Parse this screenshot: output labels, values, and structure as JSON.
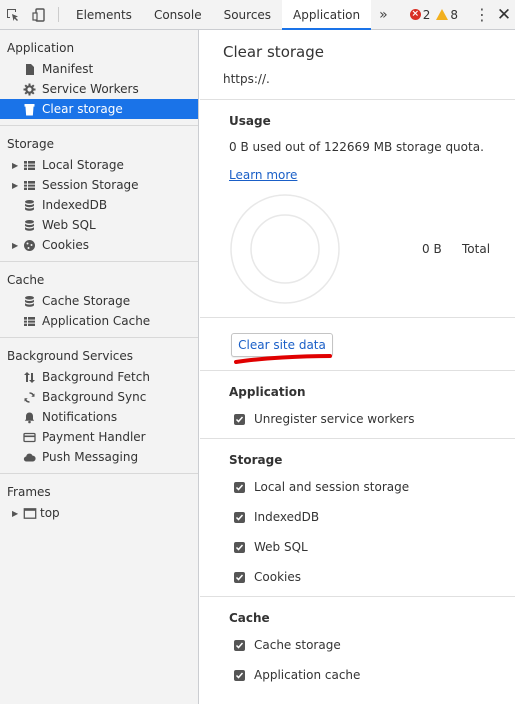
{
  "toolbar": {
    "tabs": [
      {
        "label": "Elements"
      },
      {
        "label": "Console"
      },
      {
        "label": "Sources"
      },
      {
        "label": "Application"
      }
    ],
    "more_tabs": "»",
    "errors": "2",
    "warnings": "8",
    "active_tab_color": "#1a73e8",
    "error_color": "#d93025",
    "warning_color": "#f2b01e"
  },
  "sidebar": {
    "application": {
      "title": "Application",
      "items": [
        {
          "label": "Manifest",
          "icon": "document-icon"
        },
        {
          "label": "Service Workers",
          "icon": "gear-icon"
        },
        {
          "label": "Clear storage",
          "icon": "trash-icon",
          "selected": true
        }
      ]
    },
    "storage": {
      "title": "Storage",
      "items": [
        {
          "label": "Local Storage",
          "icon": "grid-icon",
          "expandable": true
        },
        {
          "label": "Session Storage",
          "icon": "grid-icon",
          "expandable": true
        },
        {
          "label": "IndexedDB",
          "icon": "database-icon"
        },
        {
          "label": "Web SQL",
          "icon": "database-icon"
        },
        {
          "label": "Cookies",
          "icon": "cookie-icon",
          "expandable": true
        }
      ]
    },
    "cache": {
      "title": "Cache",
      "items": [
        {
          "label": "Cache Storage",
          "icon": "database-icon"
        },
        {
          "label": "Application Cache",
          "icon": "grid-icon"
        }
      ]
    },
    "background": {
      "title": "Background Services",
      "items": [
        {
          "label": "Background Fetch",
          "icon": "up-down-arrows-icon"
        },
        {
          "label": "Background Sync",
          "icon": "sync-icon"
        },
        {
          "label": "Notifications",
          "icon": "bell-icon"
        },
        {
          "label": "Payment Handler",
          "icon": "card-icon"
        },
        {
          "label": "Push Messaging",
          "icon": "cloud-icon"
        }
      ]
    },
    "frames": {
      "title": "Frames",
      "items": [
        {
          "label": "top",
          "icon": "frame-icon",
          "expandable": true
        }
      ]
    },
    "selected_color": "#1a73e8"
  },
  "main": {
    "title": "Clear storage",
    "origin": "https://.",
    "usage": {
      "heading": "Usage",
      "text": "0 B used out of 122669 MB storage quota.",
      "learn_more": "Learn more",
      "legend_value": "0 B",
      "legend_label": "Total"
    },
    "clear_button": "Clear site data",
    "groups": {
      "application": {
        "heading": "Application",
        "options": [
          {
            "label": "Unregister service workers",
            "checked": true
          }
        ]
      },
      "storage": {
        "heading": "Storage",
        "options": [
          {
            "label": "Local and session storage",
            "checked": true
          },
          {
            "label": "IndexedDB",
            "checked": true
          },
          {
            "label": "Web SQL",
            "checked": true
          },
          {
            "label": "Cookies",
            "checked": true
          }
        ]
      },
      "cache": {
        "heading": "Cache",
        "options": [
          {
            "label": "Cache storage",
            "checked": true
          },
          {
            "label": "Application cache",
            "checked": true
          }
        ]
      }
    },
    "link_color": "#1a5fc7",
    "annotation_color": "#e00000"
  }
}
